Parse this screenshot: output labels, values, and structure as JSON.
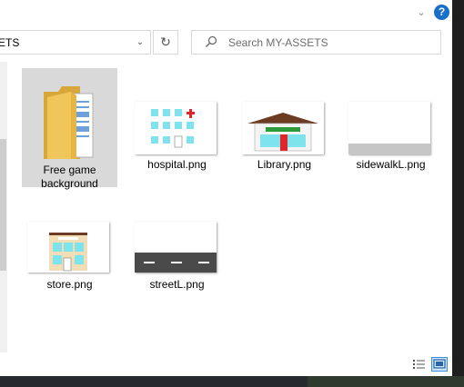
{
  "address": {
    "path_fragment": "ETS"
  },
  "search": {
    "placeholder": "Search MY-ASSETS"
  },
  "help": {
    "label": "?"
  },
  "items": [
    {
      "label": "Free game background",
      "type": "folder"
    },
    {
      "label": "hospital.png",
      "type": "image"
    },
    {
      "label": "Library.png",
      "type": "image"
    },
    {
      "label": "sidewalkL.png",
      "type": "image"
    },
    {
      "label": "store.png",
      "type": "image"
    },
    {
      "label": "streetL.png",
      "type": "image"
    }
  ],
  "colors": {
    "selection": "#d9d9d9",
    "accent": "#1a6fc9",
    "roof": "#6b3b22",
    "library_sign": "#2e9b3a",
    "door_red": "#e0262a",
    "window_cyan": "#7fe3ee",
    "road": "#4a4a4a"
  },
  "icons": {
    "refresh": "refresh-icon",
    "search": "search-icon",
    "folder": "folder-icon",
    "details_view": "details-view-icon",
    "large_icons_view": "large-icons-view-icon"
  }
}
